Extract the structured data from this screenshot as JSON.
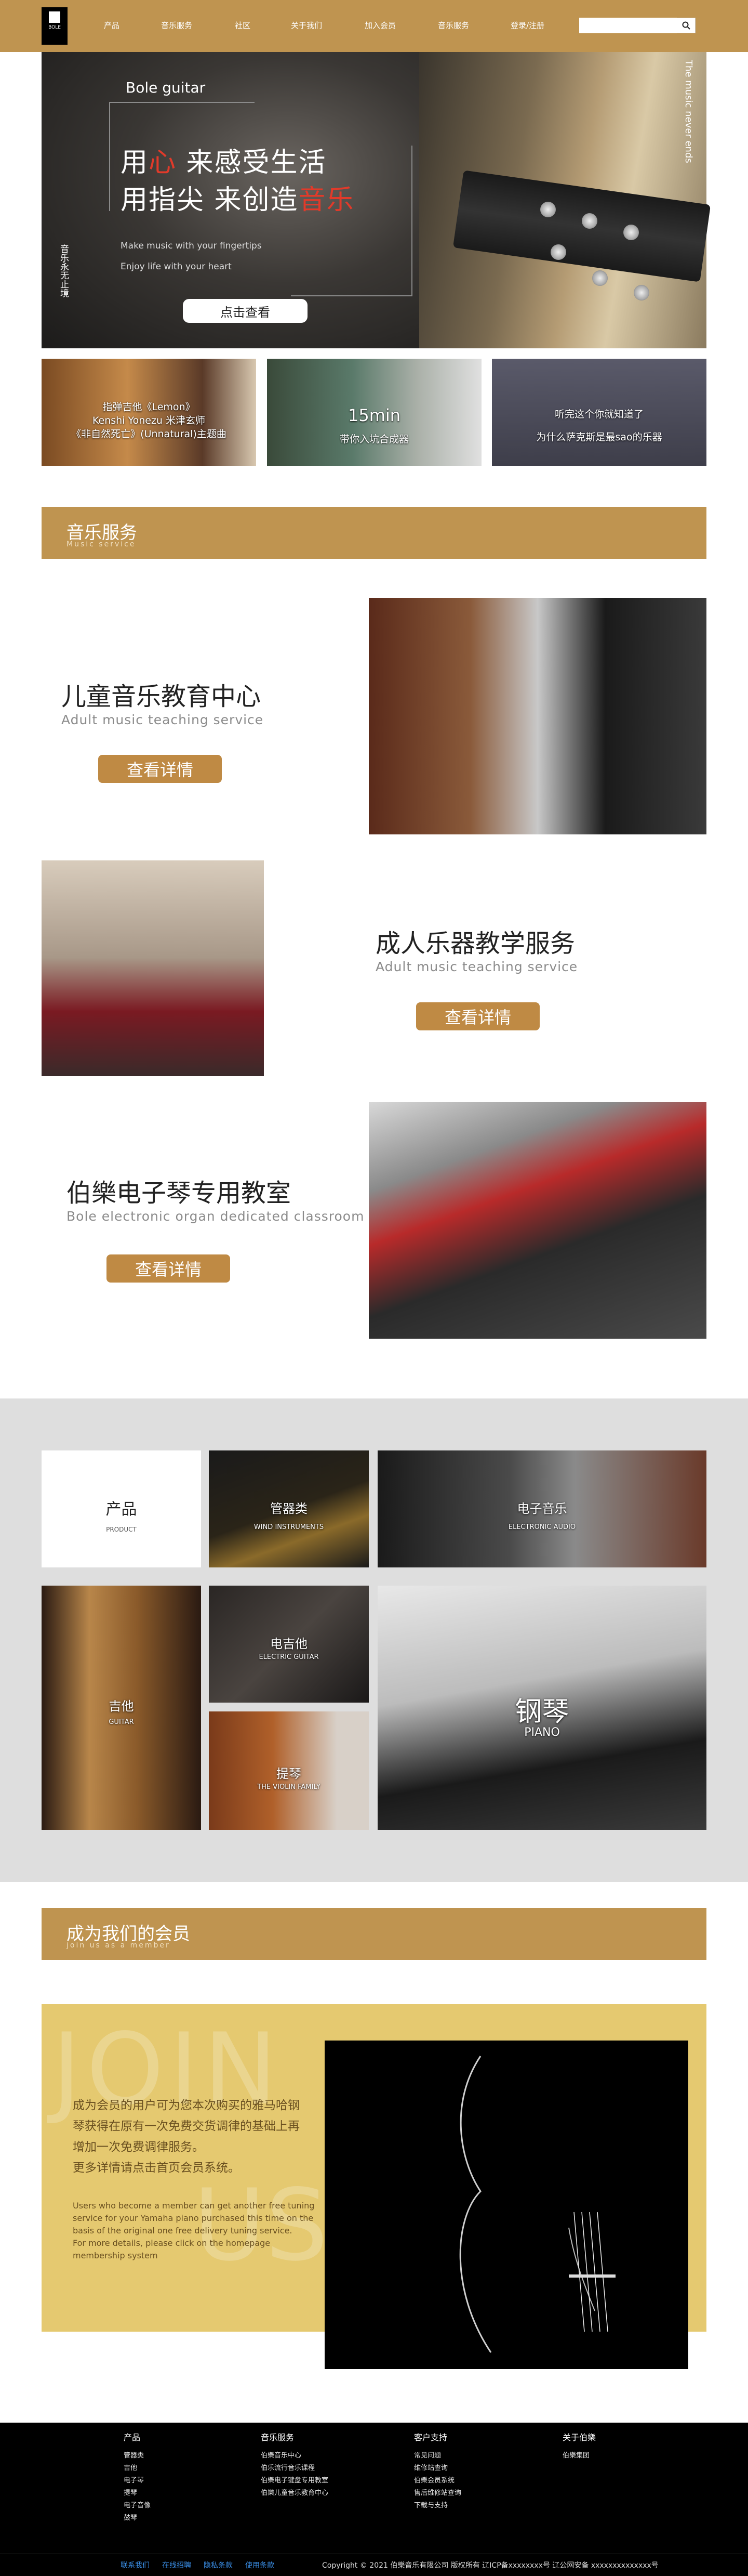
{
  "header": {
    "logo_text": "BOLE",
    "nav": [
      "产品",
      "音乐服务",
      "社区",
      "关于我们",
      "加入会员",
      "音乐服务",
      "登录/注册"
    ],
    "search_placeholder": ""
  },
  "hero": {
    "brand": "Bole guitar",
    "line1_a": "用",
    "line1_red": "心",
    "line1_b": " 来感受生活",
    "line2_a": "用指尖 来创造",
    "line2_red": "音乐",
    "en1": "Make music with your fingertips",
    "en2": "Enjoy life with your heart",
    "vertical": "音乐永无止境",
    "cta": "点击查看",
    "right_vertical": "The music never ends"
  },
  "videos": [
    {
      "lines": [
        "指弹吉他《Lemon》",
        "Kenshi Yonezu 米津玄师",
        "《非自然死亡》(Unnatural)主题曲"
      ]
    },
    {
      "lines": [
        "15min",
        "带你入坑合成器"
      ]
    },
    {
      "lines": [
        "听完这个你就知道了",
        "为什么萨克斯是最sao的乐器"
      ]
    }
  ],
  "music_service": {
    "title": "音乐服务",
    "subtitle": "Music service"
  },
  "services": [
    {
      "title": "儿童音乐教育中心",
      "subtitle": "Adult music teaching service",
      "button": "查看详情"
    },
    {
      "title": "成人乐器教学服务",
      "subtitle": "Adult music teaching service",
      "button": "查看详情"
    },
    {
      "title": "伯樂电子琴专用教室",
      "subtitle": "Bole electronic organ dedicated classroom",
      "button": "查看详情"
    }
  ],
  "products": {
    "label": "产品",
    "label_en": "PRODUCT",
    "items": [
      {
        "zh": "管器类",
        "en": "WIND INSTRUMENTS"
      },
      {
        "zh": "电子音乐",
        "en": "ELECTRONIC AUDIO"
      },
      {
        "zh": "吉他",
        "en": "GUITAR"
      },
      {
        "zh": "电吉他",
        "en": "ELECTRIC GUITAR"
      },
      {
        "zh": "提琴",
        "en": "THE VIOLIN FAMILY"
      },
      {
        "zh": "钢琴",
        "en": "PIANO"
      }
    ]
  },
  "member": {
    "title": "成为我们的会员",
    "subtitle": "join us as a member",
    "bg_word1": "JOIN",
    "bg_word2": "US",
    "zh": [
      "成为会员的用户可为您本次购买的雅马哈钢",
      "琴获得在原有一次免费交货调律的基础上再",
      "增加一次免费调律服务。",
      "更多详情请点击首页会员系统。"
    ],
    "en": [
      "Users who become a member can get another free tuning",
      "service for your Yamaha piano purchased this time on the",
      "basis of the original one free delivery tuning service.",
      "For more details, please click on the homepage",
      "membership system"
    ]
  },
  "footer": {
    "columns": [
      {
        "title": "产品",
        "items": [
          "管器类",
          "吉他",
          "电子琴",
          "提琴",
          "电子音像",
          "鼓琴"
        ]
      },
      {
        "title": "音乐服务",
        "items": [
          "伯樂音乐中心",
          "伯乐流行音乐课程",
          "伯樂电子键盘专用教室",
          "伯樂儿童音乐教育中心"
        ]
      },
      {
        "title": "客户支持",
        "items": [
          "常见问题",
          "维修站查询",
          "伯樂会员系统",
          "售后维修站查询",
          "下载与支持"
        ]
      },
      {
        "title": "关于伯樂",
        "items": [
          "伯樂集团"
        ]
      }
    ],
    "bottom_links": [
      "联系我们",
      "在线招聘",
      "隐私条款",
      "使用条款"
    ],
    "copyright": "Copyright © 2021 伯樂音乐有限公司 版权所有 辽ICP备xxxxxxxx号 辽公网安备 xxxxxxxxxxxxxx号"
  }
}
